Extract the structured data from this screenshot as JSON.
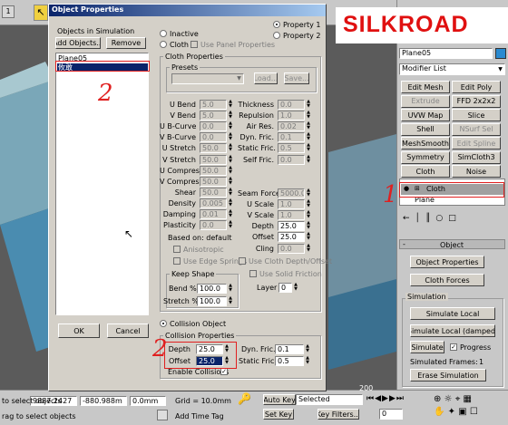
{
  "viewport": {
    "tiles": [
      "1",
      "1",
      "1",
      "1"
    ]
  },
  "status": {
    "coord_x": "9887.2427",
    "coord_y": "-880.988m",
    "coord_z": "0.0mm",
    "grid": "Grid = 10.0mm",
    "auto_key": "Auto Key",
    "selected": "Selected",
    "set_key": "Set Key",
    "key_filters": "Key Filters...",
    "add_time_tag": "Add Time Tag",
    "prompt_1": "to select objects",
    "prompt_2": "rag to select objects",
    "ruler_200": "200",
    "frame": "0"
  },
  "dialog": {
    "title": "Object Properties",
    "objects_group": "Objects in Simulation",
    "add_objects": "Add Objects...",
    "remove": "Remove",
    "objects": [
      "Plane05",
      "攸敢"
    ],
    "ok": "OK",
    "cancel": "Cancel",
    "inactive": "Inactive",
    "property1": "Property 1",
    "property2": "Property 2",
    "cloth": "Cloth",
    "use_panel": "Use Panel Properties",
    "cloth_props": "Cloth Properties",
    "presets": "Presets",
    "load": "Load...",
    "save": "Save...",
    "left_params": [
      {
        "label": "U Bend",
        "value": "5.0"
      },
      {
        "label": "V Bend",
        "value": "5.0"
      },
      {
        "label": "U B-Curve",
        "value": "0.0"
      },
      {
        "label": "V B-Curve",
        "value": "0.0"
      },
      {
        "label": "U Stretch",
        "value": "50.0"
      },
      {
        "label": "V Stretch",
        "value": "50.0"
      },
      {
        "label": "U Compress",
        "value": "50.0"
      },
      {
        "label": "V Compress",
        "value": "50.0"
      },
      {
        "label": "Shear",
        "value": "50.0"
      },
      {
        "label": "Density",
        "value": "0.005"
      },
      {
        "label": "Damping",
        "value": "0.01"
      },
      {
        "label": "Plasticity",
        "value": "0.0"
      }
    ],
    "right_params": [
      {
        "label": "Thickness",
        "value": "0.0"
      },
      {
        "label": "Repulsion",
        "value": "1.0"
      },
      {
        "label": "Air Res.",
        "value": "0.02"
      },
      {
        "label": "Dyn. Fric.",
        "value": "0.1"
      },
      {
        "label": "Static Fric.",
        "value": "0.5"
      },
      {
        "label": "Self Fric.",
        "value": "0.0"
      }
    ],
    "right_params2": [
      {
        "label": "Seam Force",
        "value": "5000.0"
      },
      {
        "label": "U Scale",
        "value": "1.0"
      },
      {
        "label": "V Scale",
        "value": "1.0"
      },
      {
        "label": "Depth",
        "value": "25.0"
      },
      {
        "label": "Offset",
        "value": "25.0"
      },
      {
        "label": "Cling",
        "value": "0.0"
      }
    ],
    "based_on": "Based on: default",
    "anisotropic": "Anisotropic",
    "use_edge": "Use Edge Springs",
    "use_cloth_depth": "Use Cloth Depth/Offset",
    "keep_shape": "Keep Shape",
    "use_solid": "Use Solid Friction",
    "bend_pct": "Bend %",
    "bend_val": "100.0",
    "stretch_pct": "Stretch %",
    "stretch_val": "100.0",
    "layer": "Layer",
    "layer_val": "0",
    "collision_object": "Collision Object",
    "collision_props": "Collision Properties",
    "depth": "Depth",
    "depth_val": "25.0",
    "offset": "Offset",
    "offset_val": "25.0",
    "dyn_fric": "Dyn. Fric.",
    "dyn_val": "0.1",
    "static_fric": "Static Fric.",
    "static_val": "0.5",
    "enable_coll": "Enable Collisions"
  },
  "panel": {
    "logo": "SILKROAD",
    "object_name": "Plane05",
    "modifier_list": "Modifier List",
    "mod_buttons": [
      "Edit Mesh",
      "Edit Poly",
      "Extrude",
      "FFD 2x2x2",
      "UVW Map",
      "Slice",
      "Shell",
      "NSurf Sel",
      "MeshSmooth",
      "Edit Spline",
      "Symmetry",
      "SimCloth3",
      "Cloth",
      "Noise"
    ],
    "stack": [
      "Cloth",
      "Plane"
    ],
    "rollout_object": "Object",
    "object_properties": "Object Properties",
    "cloth_forces": "Cloth Forces",
    "simulation": "Simulation",
    "simulate_local": "Simulate Local",
    "simulate_local_damped": "Simulate Local (damped)",
    "simulate": "Simulate",
    "progress": "Progress",
    "simulated_frames_label": "Simulated Frames:",
    "simulated_frames": "1",
    "erase": "Erase Simulation"
  },
  "annotations": {
    "mark1": "2",
    "mark2": "1",
    "mark3": "2"
  },
  "colors": {
    "accent": "#0a246a",
    "annotation": "#e02020",
    "dialog": "#d4d0c8"
  }
}
